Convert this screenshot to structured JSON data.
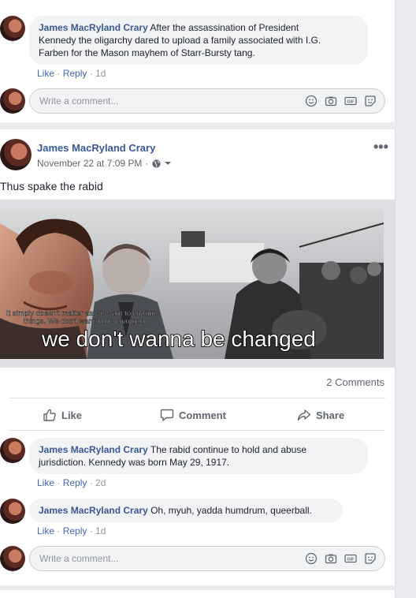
{
  "comments_top": [
    {
      "author": "James MacRyland Crary",
      "text_line1": "After the assassination of President",
      "text_line2": "Kennedy the oligarchy dared to upload a family associated with I.G.",
      "text_line3": "Farben for the Mason mayhem of Starr-Bursty tang.",
      "like": "Like",
      "reply": "Reply",
      "time": "1d"
    }
  ],
  "comment_input_placeholder": "Write a comment...",
  "post": {
    "author": "James MacRyland Crary",
    "timestamp": "November 22 at 7:09 PM",
    "privacy_icon": "globe-icon",
    "text": "Thus spake the rabid",
    "image_caption_small_line1": "It simply doesn't matter as we want to change",
    "image_caption_small_line2": "things. We don't want to be changed.",
    "image_caption": "we don't wanna be changed",
    "comments_count": "2 Comments",
    "like_label": "Like",
    "comment_label": "Comment",
    "share_label": "Share"
  },
  "comments_bottom": [
    {
      "author": "James MacRyland Crary",
      "text_line1": "The rabid continue to hold and abuse",
      "text_line2": "jurisdiction. Kennedy was born May 29, 1917.",
      "like": "Like",
      "reply": "Reply",
      "time": "2d"
    },
    {
      "author": "James MacRyland Crary",
      "text_line1": "Oh, myuh, yadda humdrum, queerball.",
      "like": "Like",
      "reply": "Reply",
      "time": "1d"
    }
  ],
  "colors": {
    "link": "#385898",
    "action_link": "#4267b2",
    "bubble": "#f2f3f5",
    "page_bg": "#e9ebee"
  }
}
